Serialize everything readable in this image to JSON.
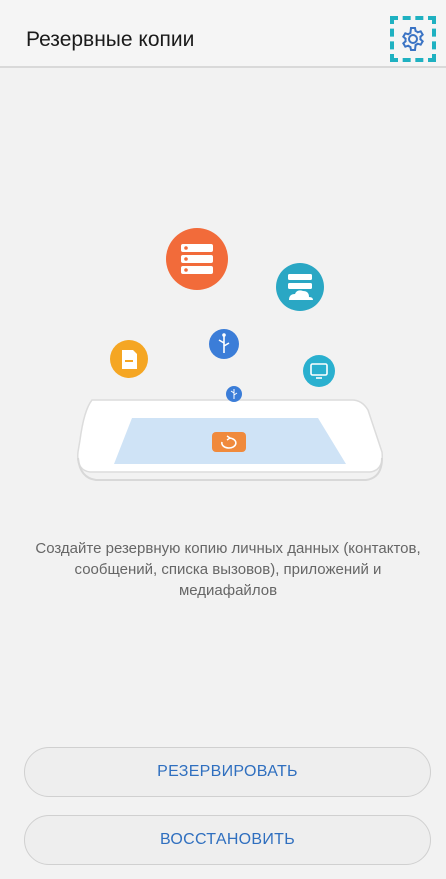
{
  "header": {
    "title": "Резервные копии",
    "settings_icon": "gear-icon"
  },
  "illustration": {
    "icons": [
      "server-icon",
      "cloud-storage-icon",
      "sd-card-icon",
      "usb-icon",
      "monitor-icon",
      "small-usb-icon",
      "backup-phone-icon"
    ],
    "colors": {
      "server": "#f26b3a",
      "cloud": "#2aa7c4",
      "sdcard": "#f5a623",
      "usb": "#3b7dd8",
      "monitor": "#2ab0cf",
      "phone_screen": "#cfe3f6",
      "phone_badge": "#f08a3c"
    }
  },
  "main": {
    "description": "Создайте резервную копию личных данных (контактов, сообщений, списка вызовов), приложений и медиафайлов"
  },
  "actions": {
    "backup_label": "РЕЗЕРВИРОВАТЬ",
    "restore_label": "ВОССТАНОВИТЬ"
  },
  "theme": {
    "accent": "#2f6fbf",
    "highlight": "#1fb1c1"
  }
}
